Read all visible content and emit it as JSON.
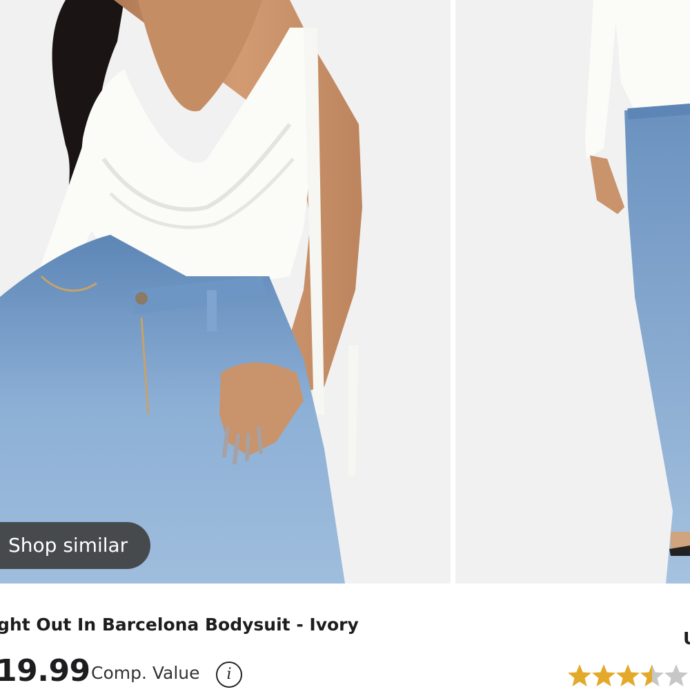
{
  "product": {
    "title_visible": "ght Out In Barcelona Bodysuit - Ivory",
    "price_visible": "19.99",
    "comp_value_label": "Comp. Value",
    "info_icon": "info-icon"
  },
  "overlay": {
    "shop_similar_label": "Shop similar"
  },
  "next_card": {
    "title_fragment": "U",
    "rating": 3.5,
    "rating_max": 5,
    "star_fill_color": "#e3a92a",
    "star_empty_color": "#c7c7c7"
  },
  "images": [
    {
      "description_icon": "product-photo-front"
    },
    {
      "description_icon": "product-photo-full-length"
    }
  ],
  "colors": {
    "background": "#f1f1f1",
    "text": "#1d1d1f",
    "pill_bg": "#404040"
  }
}
